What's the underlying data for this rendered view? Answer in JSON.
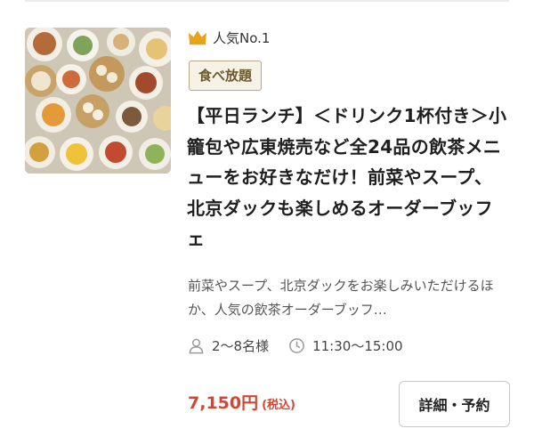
{
  "ranking": {
    "label": "人気No.1",
    "icon": "crown-icon",
    "icon_color": "#e8a418"
  },
  "tag": {
    "label": "食べ放題"
  },
  "plan": {
    "title": "【平日ランチ】＜ドリンク1杯付き＞小籠包や広東焼売など全24品の飲茶メニューをお好きなだけ！前菜やスープ、北京ダックも楽しめるオーダーブッフェ",
    "description": "前菜やスープ、北京ダックをお楽しみいただけるほか、人気の飲茶オーダーブッフ…"
  },
  "meta": {
    "guests": {
      "icon": "person-icon",
      "value": "2〜8名様"
    },
    "time": {
      "icon": "clock-icon",
      "value": "11:30〜15:00"
    }
  },
  "price": {
    "amount": "7,150円",
    "tax_note": "(税込)",
    "color": "#d04832"
  },
  "actions": {
    "detail_label": "詳細・予約"
  },
  "thumbnail": {
    "alt": "dim-sum-buffet-photo"
  }
}
